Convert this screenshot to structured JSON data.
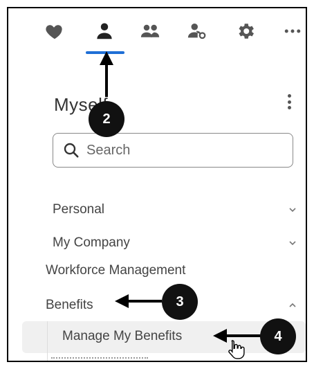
{
  "nav": {
    "icons": [
      {
        "name": "heart-icon"
      },
      {
        "name": "person-icon",
        "active": true
      },
      {
        "name": "people-icon"
      },
      {
        "name": "person-key-icon"
      },
      {
        "name": "gear-icon"
      },
      {
        "name": "more-icon"
      }
    ],
    "active_color": "#1f6fd6"
  },
  "section": {
    "title": "Myself"
  },
  "search": {
    "placeholder": "Search"
  },
  "menu": [
    {
      "label": "Personal",
      "chevron": "down"
    },
    {
      "label": "My Company",
      "chevron": "down"
    },
    {
      "label": "Workforce Management"
    },
    {
      "label": "Benefits",
      "chevron": "up"
    }
  ],
  "submenu": {
    "label": "Manage My Benefits"
  },
  "callouts": [
    {
      "number": "2"
    },
    {
      "number": "3"
    },
    {
      "number": "4"
    }
  ]
}
